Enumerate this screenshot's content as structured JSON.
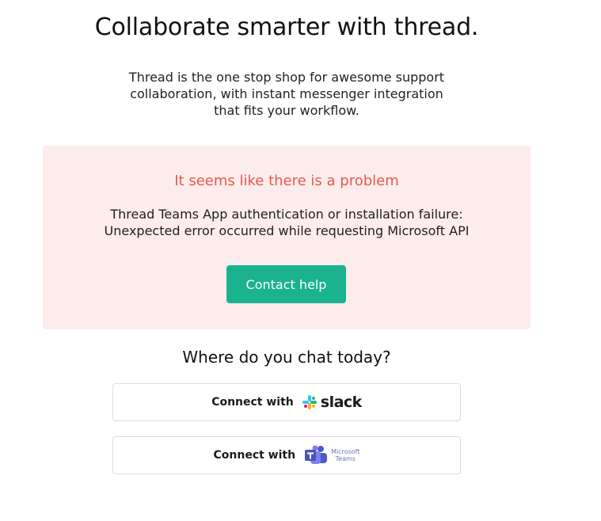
{
  "hero": {
    "title": "Collaborate smarter with thread.",
    "description_lines": [
      "Thread is the one stop shop for awesome support",
      "collaboration, with instant messenger integration",
      "that fits your workflow."
    ]
  },
  "error": {
    "title": "It seems like there is a problem",
    "message_lines": [
      "Thread Teams App authentication or installation failure:",
      "Unexpected error occurred while requesting Microsoft API"
    ],
    "contact_label": "Contact help",
    "accent_color": "#e55a50",
    "panel_color": "#fdecec",
    "button_color": "#1bb28f"
  },
  "connect": {
    "heading": "Where do you chat today?",
    "options": [
      {
        "label": "Connect with",
        "brand": "slack",
        "icon": "slack-logo-icon"
      },
      {
        "label": "Connect with",
        "brand_lines": [
          "Microsoft",
          "Teams"
        ],
        "icon": "microsoft-teams-logo-icon"
      }
    ]
  }
}
